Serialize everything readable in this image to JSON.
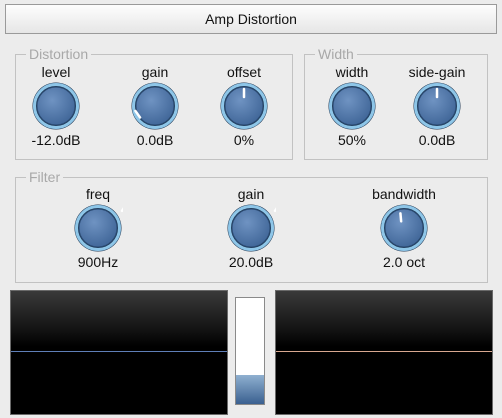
{
  "window": {
    "title": "Amp Distortion"
  },
  "distortion": {
    "title": "Distortion",
    "knobs": [
      {
        "label": "level",
        "value": "-12.0dB",
        "angle": 40
      },
      {
        "label": "gain",
        "value": "0.0dB",
        "angle": -35
      },
      {
        "label": "offset",
        "value": "0%",
        "angle": 0
      }
    ]
  },
  "width": {
    "title": "Width",
    "knobs": [
      {
        "label": "width",
        "value": "50%",
        "angle": -75
      },
      {
        "label": "side-gain",
        "value": "0.0dB",
        "angle": 0
      }
    ]
  },
  "filter": {
    "title": "Filter",
    "knobs": [
      {
        "label": "freq",
        "value": "900Hz",
        "angle": 35
      },
      {
        "label": "gain",
        "value": "20.0dB",
        "angle": 35
      },
      {
        "label": "bandwidth",
        "value": "2.0 oct",
        "angle": -5
      }
    ]
  },
  "displays": {
    "left_scope_line_color": "#5f7fb8",
    "right_scope_line_color": "#d8a890",
    "meter_level": 0.27,
    "knob_color": "#3f6597",
    "knob_ring_color": "#8ec6e8"
  }
}
